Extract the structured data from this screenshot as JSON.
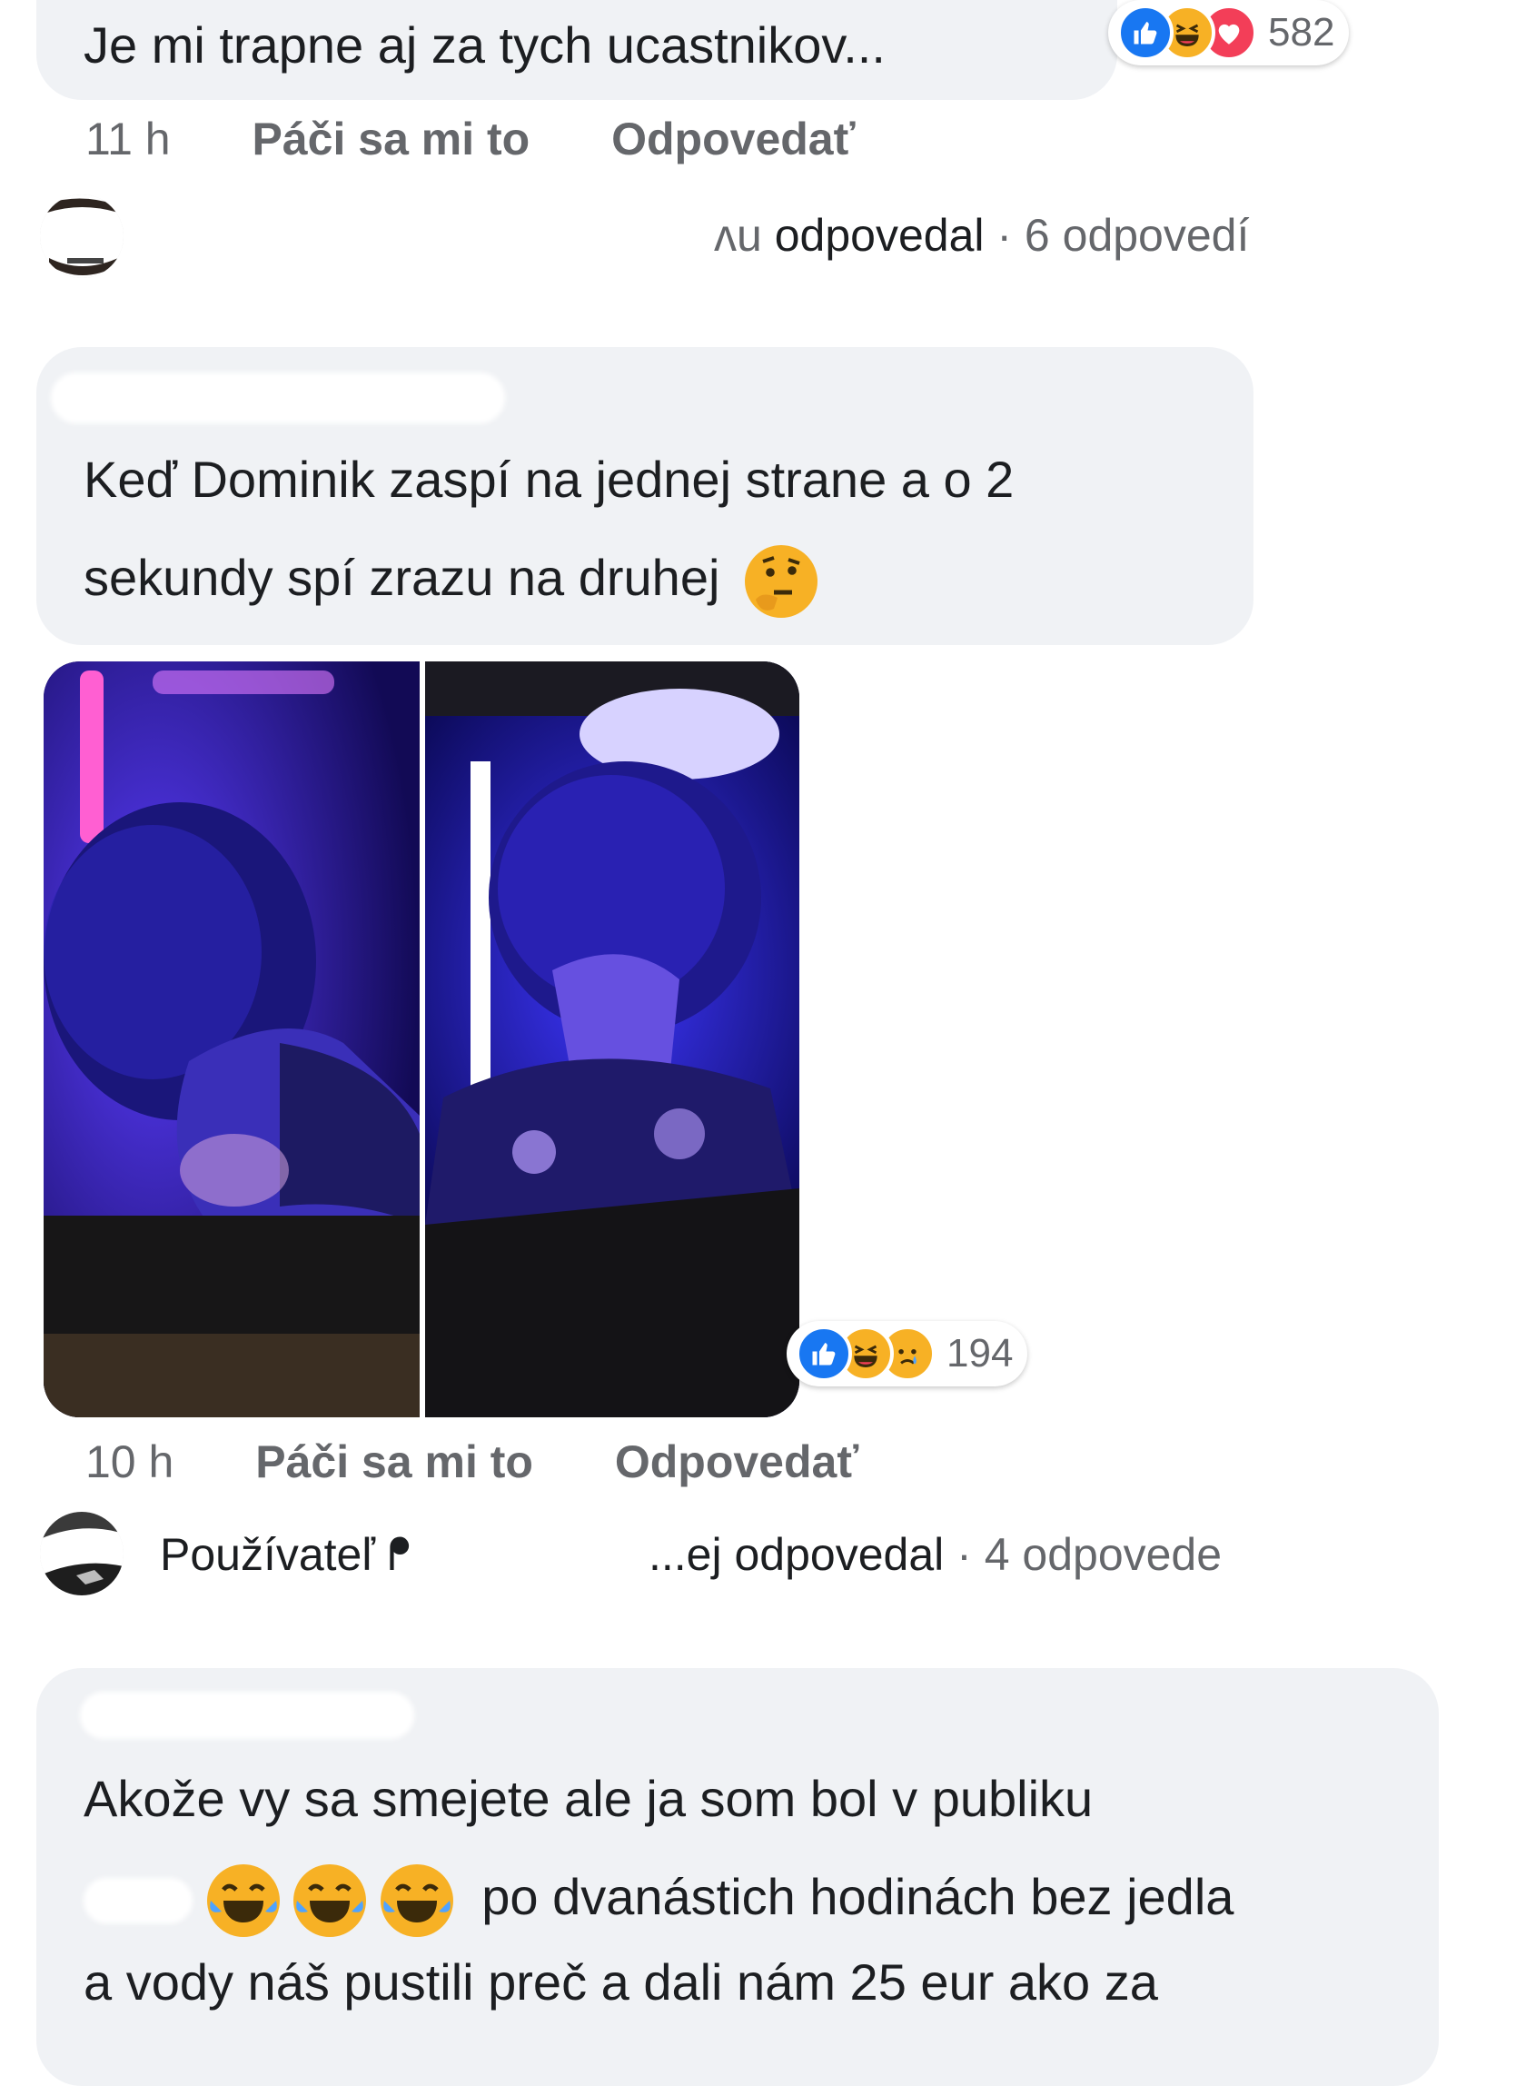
{
  "comment1": {
    "text": "Je mi trapne aj za tych ucastnikov...",
    "reaction_count": "582",
    "reactions": [
      "like-icon",
      "haha-icon",
      "love-icon"
    ],
    "time": "11 h",
    "like_label": "Páči sa mi to",
    "reply_label": "Odpovedať",
    "replies_prefix": "ᴧu",
    "replies_verb": "odpovedal",
    "replies_count": "· 6 odpovedí"
  },
  "comment2": {
    "line1": "Keď Dominik zaspí na jednej strane a o 2",
    "line2": "sekundy spí zrazu na druhej",
    "emoji": "thinking-face-emoji",
    "reaction_count": "194",
    "reactions": [
      "like-icon",
      "haha-icon",
      "sad-icon"
    ],
    "time": "10 h",
    "like_label": "Páči sa mi to",
    "reply_label": "Odpovedať",
    "replies_user": "Používateľ ᖰ",
    "replies_suffix": "...ej odpovedal",
    "replies_count": "· 4 odpovede"
  },
  "comment3": {
    "line1": "Akože vy sa smejete ale ja som bol v publiku",
    "line2_text": "po dvanástich hodinách bez jedla",
    "line3": "a vody náš pustili preč a dali nám 25 eur ako za",
    "emojis": [
      "tears-of-joy-emoji",
      "tears-of-joy-emoji",
      "tears-of-joy-emoji"
    ]
  },
  "colors": {
    "bubble": "#f0f2f5",
    "meta": "#65676b",
    "like": "#1877f2",
    "haha": "#f7b125",
    "love": "#f33e58"
  }
}
